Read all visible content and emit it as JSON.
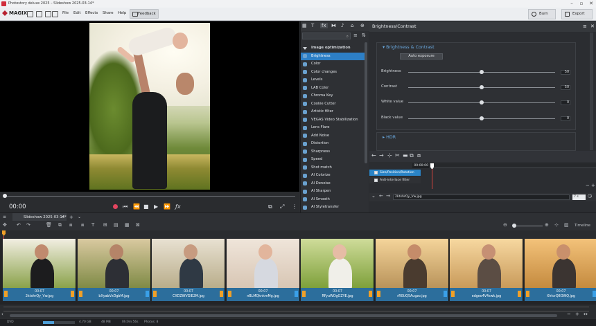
{
  "window": {
    "title": "Photostory deluxe 2025 – Slideshow 2025-03-14*"
  },
  "menubar": {
    "logo": "MAGIX",
    "menus": [
      "File",
      "Edit",
      "Effects",
      "Share",
      "Help"
    ],
    "feedback": "Feedback",
    "burn": "Burn",
    "export": "Export"
  },
  "preview": {
    "timecode": "00:00"
  },
  "effects_panel": {
    "tabs": [
      "T",
      "fx",
      "♪"
    ],
    "category": "Image optimization",
    "items": [
      "Brightness",
      "Color",
      "Color changes",
      "Levels",
      "LAB Color",
      "Chroma Key",
      "Cookie Cutter",
      "Artistic filter",
      "VEGAS Video Stabilization",
      "Lens Flare",
      "Add Noise",
      "Distortion",
      "Sharpness",
      "Speed",
      "Shot match",
      "AI Colorize",
      "AI Denoise",
      "AI Sharpen",
      "AI Smooth",
      "AI Styletransfer"
    ],
    "selected": "Brightness"
  },
  "properties": {
    "title": "Brightness/Contrast",
    "section1": "Brightness & Contrast",
    "auto_exposure": "Auto exposure",
    "params": [
      {
        "label": "Brightness",
        "value": "50",
        "pos": 0.5
      },
      {
        "label": "Contrast",
        "value": "50",
        "pos": 0.5
      },
      {
        "label": "White value",
        "value": "0",
        "pos": 0.5
      },
      {
        "label": "Black value",
        "value": "0",
        "pos": 0.5
      }
    ],
    "section2": "HDR"
  },
  "keyframes": {
    "timecode": "00:00:00",
    "track1": "Size/Position/Rotation",
    "track2": "Anti-interlace filter",
    "filename": "2ktxhrQy_Vw.jpg",
    "duration": "7 s"
  },
  "timeline": {
    "tab": "Slideshow 2025-03-14*",
    "timeline_label": "Timeline",
    "clips": [
      {
        "duration": "00:07",
        "name": "2ktxhrQy_Vw.jpg"
      },
      {
        "duration": "00:07",
        "name": "bXyabVxDgbM.jpg"
      },
      {
        "duration": "00:07",
        "name": "CXDZWVGIE2M.jpg"
      },
      {
        "duration": "00:07",
        "name": "nBLMQknkmMg.jpg"
      },
      {
        "duration": "00:07",
        "name": "RFyuWOgOZYE.jpg"
      },
      {
        "duration": "00:07",
        "name": "rR0UQ5Augzo.jpg"
      },
      {
        "duration": "00:07",
        "name": "edgeo4V4swk.jpg"
      },
      {
        "duration": "00:07",
        "name": "XhtcrQ8OWQ.jpg"
      }
    ]
  },
  "status": {
    "format": "DVD",
    "disk": "4.70 GB",
    "mem": "48 MB",
    "time": "0h:0m:56s",
    "photos": "Photos: 8",
    "mem_fraction": 0.35
  }
}
